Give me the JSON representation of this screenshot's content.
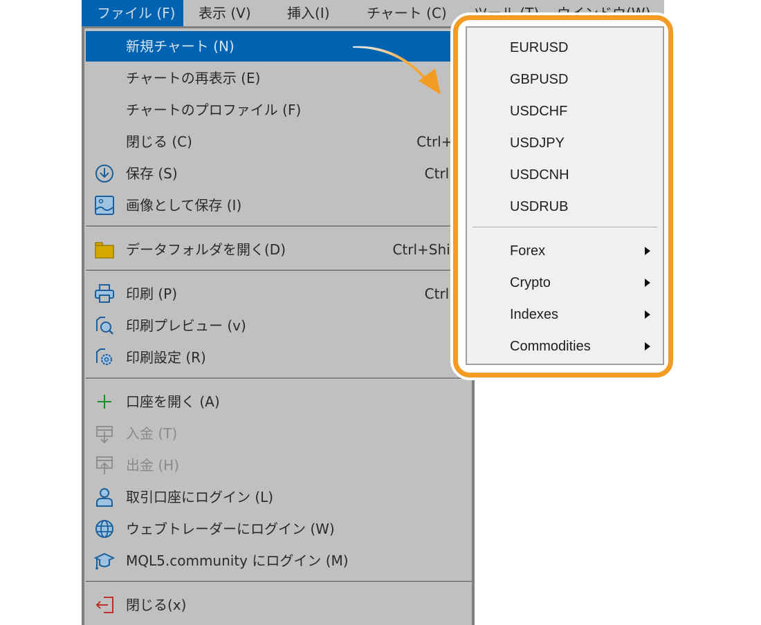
{
  "menubar": {
    "items": [
      {
        "label": "ファイル (F)",
        "active": true
      },
      {
        "label": "表示 (V)"
      },
      {
        "label": "挿入(I)"
      },
      {
        "label": "チャート (C)"
      },
      {
        "label": "ツール (T)"
      },
      {
        "label": "ウインドウ(W)"
      }
    ]
  },
  "file_menu": {
    "items": [
      {
        "label": "新規チャート (N)",
        "highlighted": true,
        "icon": null,
        "shortcut": ""
      },
      {
        "label": "チャートの再表示 (E)",
        "icon": null,
        "shortcut": ""
      },
      {
        "label": "チャートのプロファイル (F)",
        "icon": null,
        "shortcut": ""
      },
      {
        "label": "閉じる (C)",
        "icon": null,
        "shortcut": "Ctrl+F"
      },
      {
        "label": "保存 (S)",
        "icon": "save-download-icon",
        "shortcut": "Ctrl+"
      },
      {
        "label": "画像として保存 (I)",
        "icon": "image-icon",
        "shortcut": ""
      },
      {
        "label": "データフォルダを開く(D)",
        "icon": "folder-icon",
        "shortcut": "Ctrl+Shift+"
      },
      {
        "label": "印刷 (P)",
        "icon": "printer-icon",
        "shortcut": "Ctrl+"
      },
      {
        "label": "印刷プレビュー (v)",
        "icon": "print-preview-icon",
        "shortcut": ""
      },
      {
        "label": "印刷設定 (R)",
        "icon": "print-settings-icon",
        "shortcut": ""
      },
      {
        "label": "口座を開く (A)",
        "icon": "plus-icon",
        "shortcut": ""
      },
      {
        "label": "入金 (T)",
        "icon": "deposit-icon",
        "disabled": true,
        "shortcut": ""
      },
      {
        "label": "出金 (H)",
        "icon": "withdraw-icon",
        "disabled": true,
        "shortcut": ""
      },
      {
        "label": "取引口座にログイン (L)",
        "icon": "user-icon",
        "shortcut": ""
      },
      {
        "label": "ウェブトレーダーにログイン (W)",
        "icon": "globe-icon",
        "shortcut": ""
      },
      {
        "label": "MQL5.community にログイン (M)",
        "icon": "graduation-cap-icon",
        "shortcut": ""
      },
      {
        "label": "閉じる(x)",
        "icon": "exit-icon",
        "shortcut": ""
      }
    ]
  },
  "submenu": {
    "symbols": [
      "EURUSD",
      "GBPUSD",
      "USDCHF",
      "USDJPY",
      "USDCNH",
      "USDRUB"
    ],
    "categories": [
      "Forex",
      "Crypto",
      "Indexes",
      "Commodities"
    ]
  },
  "colors": {
    "highlight": "#0063b1",
    "menu_bg": "#c0c0c0",
    "callout": "#f29c24",
    "submenu_bg": "#f0f0f0"
  }
}
